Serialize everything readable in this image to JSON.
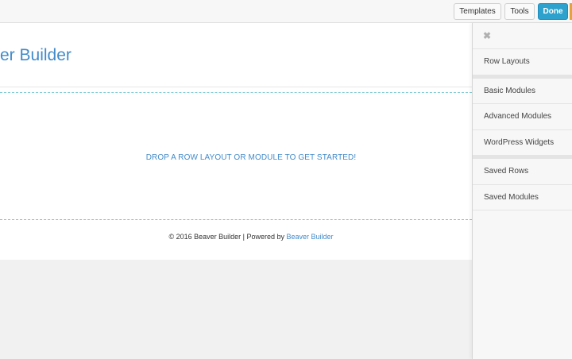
{
  "toolbar": {
    "templates_label": "Templates",
    "tools_label": "Tools",
    "done_label": "Done"
  },
  "page": {
    "site_title": "er Builder",
    "drop_message": "DROP A ROW LAYOUT OR MODULE TO GET STARTED!",
    "footer": {
      "text": "© 2016 Beaver Builder | Powered by ",
      "link": "Beaver Builder"
    }
  },
  "panel": {
    "close_icon": "close-icon",
    "items": [
      {
        "label": "Row Layouts"
      },
      {
        "label": "Basic Modules"
      },
      {
        "label": "Advanced Modules"
      },
      {
        "label": "WordPress Widgets"
      },
      {
        "label": "Saved Rows"
      },
      {
        "label": "Saved Modules"
      }
    ]
  },
  "colors": {
    "accent": "#2ea2cc",
    "link": "#428bca",
    "dashed_border": "#7ecbd4"
  }
}
